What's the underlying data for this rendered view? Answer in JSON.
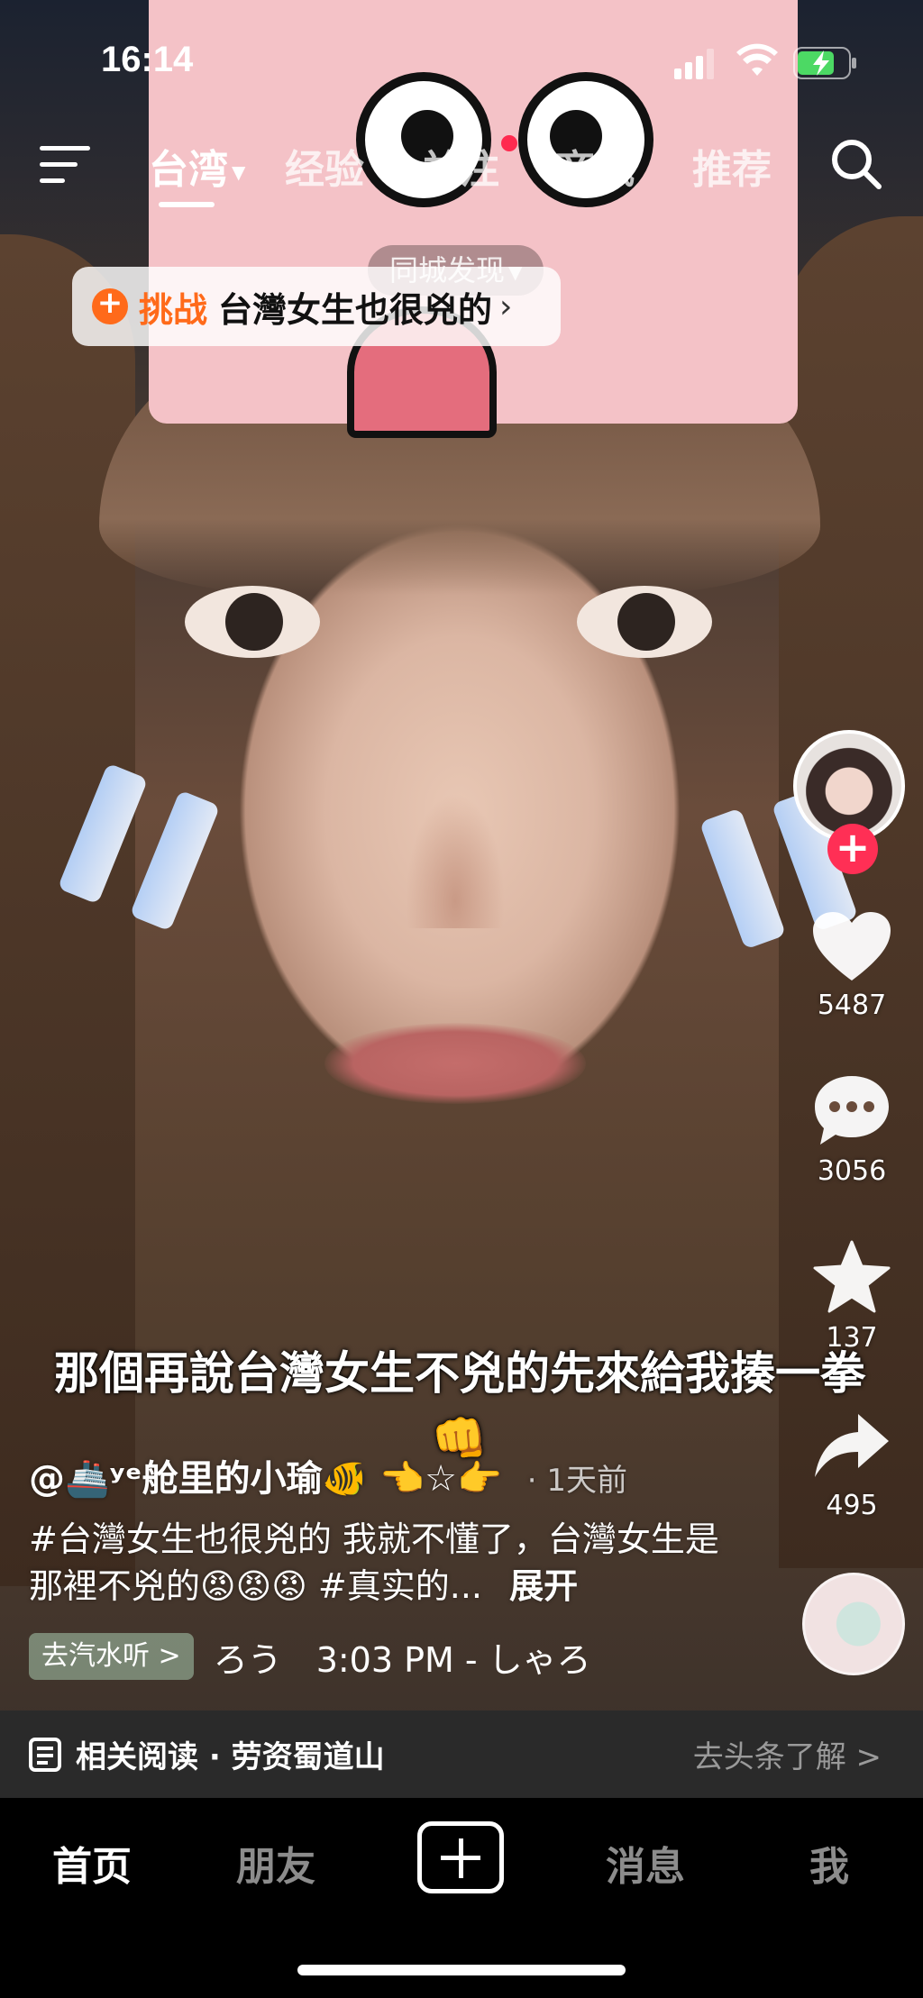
{
  "status": {
    "time": "16:14"
  },
  "nav": {
    "tabs": [
      {
        "label": "台湾",
        "active": true
      },
      {
        "label": "经验",
        "active": false
      },
      {
        "label": "关注",
        "active": false,
        "dot": true
      },
      {
        "label": "商城",
        "active": false
      },
      {
        "label": "推荐",
        "active": false
      }
    ],
    "sub_label": "同城发现"
  },
  "challenge": {
    "tag": "挑战",
    "title": "台灣女生也很兇的"
  },
  "caption": "那個再說台灣女生不兇的先來給我揍一拳👊",
  "rail": {
    "likes": "5487",
    "comments": "3056",
    "favorites": "137",
    "shares": "495"
  },
  "post": {
    "author": "@🚢ʸᵉ舱里的小瑜🐠 👈☆👉",
    "time_ago": "· 1天前",
    "description": "#台灣女生也很兇的 我就不懂了，台灣女生是那裡不兇的😡😡😡 #真实的...",
    "expand": "展开",
    "music_tag": "去汽水听 >",
    "music_text": "ろう　3:03 PM - しゃろ"
  },
  "related": {
    "text": "相关阅读 · 劳资蜀道山",
    "link": "去头条了解 >"
  },
  "tabbar": {
    "home": "首页",
    "friends": "朋友",
    "messages": "消息",
    "me": "我"
  },
  "colors": {
    "accent": "#ff2f55",
    "challenge_orange": "#ff6a1a"
  }
}
